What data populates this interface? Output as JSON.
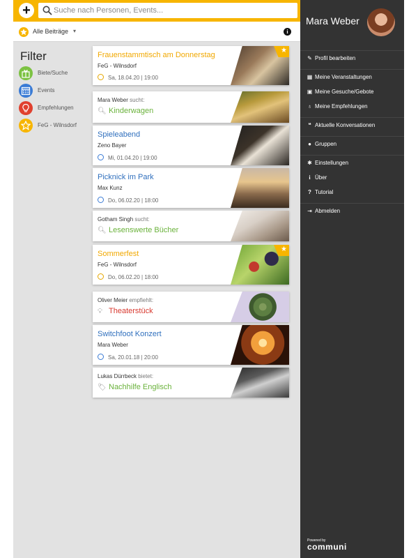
{
  "topbar": {
    "add_label": "+",
    "search_placeholder": "Suche nach Personen, Events..."
  },
  "filterbar": {
    "selected": "Alle Beiträge",
    "chevron": "▾",
    "info": "i"
  },
  "filter": {
    "title": "Filter",
    "items": [
      {
        "label": "Biete/Suche",
        "color": "#7cc242",
        "icon": "gift-icon"
      },
      {
        "label": "Events",
        "color": "#3a7bd5",
        "icon": "calendar-icon"
      },
      {
        "label": "Empfehlungen",
        "color": "#e0402e",
        "icon": "lightbulb-icon"
      },
      {
        "label": "FeG - Wilnsdorf",
        "color": "#f7b500",
        "icon": "star-icon"
      }
    ]
  },
  "posts": [
    {
      "type": "event",
      "title": "Frauenstammtisch am Donnerstag",
      "sub": "FeG - Wilnsdorf",
      "date": "Sa, 18.04.20 | 19:00",
      "featured": true
    },
    {
      "type": "request",
      "who": "Mara Weber",
      "verb": "sucht:",
      "what": "Kinderwagen"
    },
    {
      "type": "event",
      "title": "Spieleabend",
      "sub": "Zeno Bayer",
      "date": "Mi, 01.04.20 | 19:00",
      "featured": false
    },
    {
      "type": "event",
      "title": "Picknick im Park",
      "sub": "Max Kunz",
      "date": "Do, 06.02.20 | 18:00",
      "featured": false
    },
    {
      "type": "request",
      "who": "Gotham Singh",
      "verb": "sucht:",
      "what": "Lesenswerte Bücher"
    },
    {
      "type": "event",
      "title": "Sommerfest",
      "sub": "FeG - Wilnsdorf",
      "date": "Do, 06.02.20 | 18:00",
      "featured": true
    },
    {
      "type": "recommend",
      "who": "Oliver Meier",
      "verb": "empfiehlt:",
      "what": "Theaterstück"
    },
    {
      "type": "event",
      "title": "Switchfoot Konzert",
      "sub": "Mara Weber",
      "date": "Sa, 20.01.18 | 20:00",
      "featured": false
    },
    {
      "type": "offer",
      "who": "Lukas Dürrbeck",
      "verb": "bietet:",
      "what": "Nachhilfe Englisch"
    }
  ],
  "sidebar": {
    "user_name": "Mara Weber",
    "groups": [
      [
        {
          "label": "Profil bearbeiten",
          "icon": "edit-icon"
        }
      ],
      [
        {
          "label": "Meine Veranstaltungen",
          "icon": "calendar-icon"
        },
        {
          "label": "Meine Gesuche/Gebote",
          "icon": "gift-icon"
        },
        {
          "label": "Meine Empfehlungen",
          "icon": "lightbulb-icon"
        }
      ],
      [
        {
          "label": "Aktuelle Konversationen",
          "icon": "chat-icon"
        }
      ],
      [
        {
          "label": "Gruppen",
          "icon": "users-icon"
        }
      ],
      [
        {
          "label": "Einstellungen",
          "icon": "gear-icon"
        },
        {
          "label": "Über",
          "icon": "info-icon"
        },
        {
          "label": "Tutorial",
          "icon": "question-icon"
        }
      ],
      [
        {
          "label": "Abmelden",
          "icon": "logout-icon"
        }
      ]
    ],
    "powered_by": "Powered by",
    "brand": "communi"
  },
  "colors": {
    "accent": "#f7b500",
    "sidebar": "#333333",
    "background": "#e2e2e2"
  }
}
